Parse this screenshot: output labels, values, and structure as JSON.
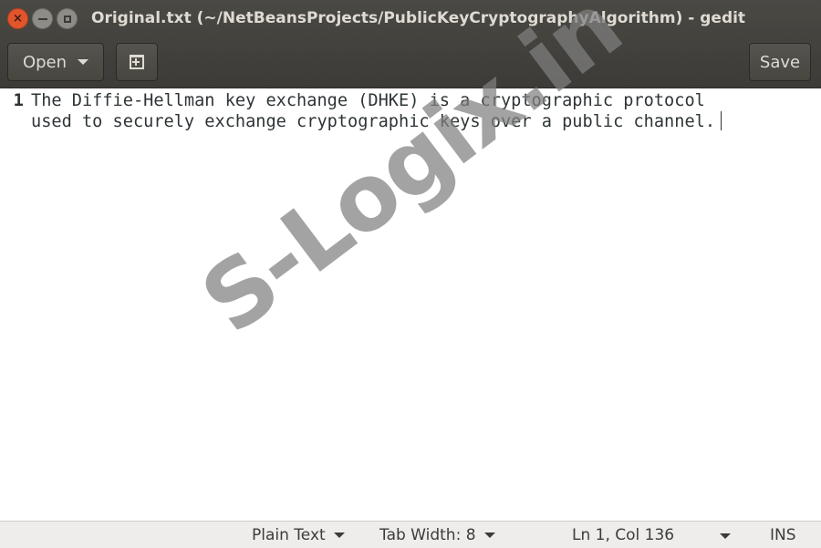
{
  "window": {
    "title": "Original.txt (~/NetBeansProjects/PublicKeyCryptographyAlgorithm) - gedit",
    "controls": {
      "close": "close-icon",
      "minimize": "minimize-icon",
      "maximize": "maximize-icon"
    }
  },
  "toolbar": {
    "open_label": "Open",
    "open_icon": "chevron-down-icon",
    "new_tab_icon": "new-tab-icon",
    "save_label": "Save"
  },
  "editor": {
    "line_number": "1",
    "lines": [
      "The Diffie-Hellman key exchange (DHKE) is a cryptographic protocol",
      "used to securely exchange cryptographic keys over a public channel."
    ]
  },
  "watermark": {
    "text": "S-Logix.in",
    "color": "#808080"
  },
  "statusbar": {
    "language": "Plain Text",
    "tab_width": "Tab Width: 8",
    "position": "Ln 1, Col 136",
    "mode": "INS"
  },
  "colors": {
    "header_bg": "#3c3b37",
    "close_button": "#e2552b",
    "text": "#2e3436",
    "statusbar_bg": "#eeedeb"
  }
}
